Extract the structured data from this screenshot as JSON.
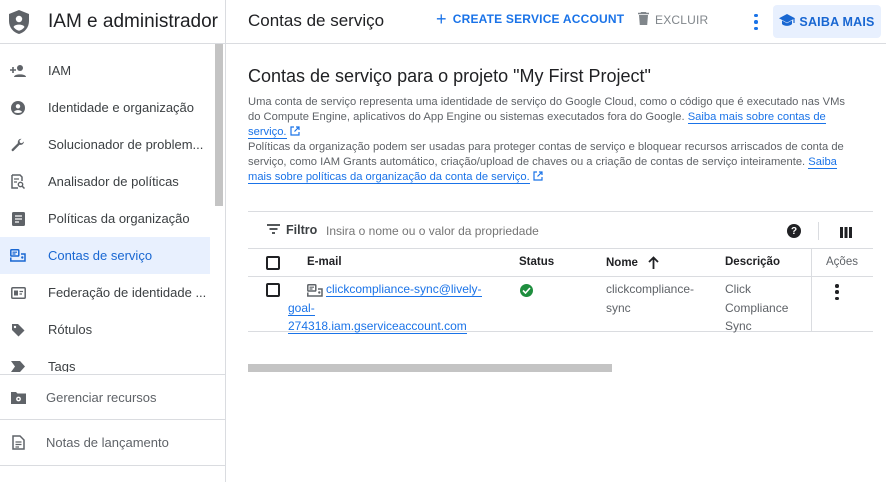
{
  "sidebar": {
    "title": "IAM e administrador",
    "items": [
      {
        "label": "IAM",
        "icon": "person-add-icon"
      },
      {
        "label": "Identidade e organização",
        "icon": "account-circle-icon"
      },
      {
        "label": "Solucionador de problem...",
        "icon": "wrench-icon"
      },
      {
        "label": "Analisador de políticas",
        "icon": "policy-analyzer-icon"
      },
      {
        "label": "Políticas da organização",
        "icon": "document-icon"
      },
      {
        "label": "Contas de serviço",
        "icon": "service-account-icon"
      },
      {
        "label": "Federação de identidade ...",
        "icon": "id-card-icon"
      },
      {
        "label": "Rótulos",
        "icon": "label-icon"
      },
      {
        "label": "Tags",
        "icon": "tag-icon"
      }
    ],
    "active_index": 5,
    "manage_resources": "Gerenciar recursos",
    "release_notes": "Notas de lançamento"
  },
  "topbar": {
    "page_title": "Contas de serviço",
    "create_label": "CREATE SERVICE ACCOUNT",
    "delete_label": "EXCLUIR",
    "learn_more_label": "SAIBA MAIS"
  },
  "main": {
    "heading": "Contas de serviço para o projeto \"My First Project\"",
    "desc1_text": "Uma conta de serviço representa uma identidade de serviço do Google Cloud, como o código que é executado nas VMs do Compute Engine, aplicativos do App Engine ou sistemas executados fora do Google. ",
    "desc1_link": "Saiba mais sobre contas de serviço.",
    "desc2_text": "Políticas da organização podem ser usadas para proteger contas de serviço e bloquear recursos arriscados de conta de serviço, como IAM Grants automático, criação/upload de chaves ou a criação de contas de serviço inteiramente. ",
    "desc2_link_line1": "Saiba mais",
    "desc2_link_line2": "sobre políticas da organização da conta de serviço."
  },
  "table": {
    "filter_label": "Filtro",
    "filter_placeholder": "Insira o nome ou o valor da propriedade",
    "help_glyph": "?",
    "headers": {
      "email": "E-mail",
      "status": "Status",
      "name": "Nome",
      "description": "Descrição",
      "actions": "Ações"
    },
    "sort_column": "name",
    "sort_direction": "ascending",
    "rows": [
      {
        "email_line1": "clickcompliance-sync@lively-",
        "email_line2": "goal-",
        "email_line3": "274318.iam.gserviceaccount.com",
        "status": "enabled",
        "name_line1": "clickcompliance-",
        "name_line2": "sync",
        "desc_line1": "Click",
        "desc_line2": "Compliance",
        "desc_line3": "Sync"
      }
    ]
  },
  "colors": {
    "accent": "#1a73e8",
    "active_bg": "#e8f0fe",
    "status_ok": "#1e8e3e"
  }
}
